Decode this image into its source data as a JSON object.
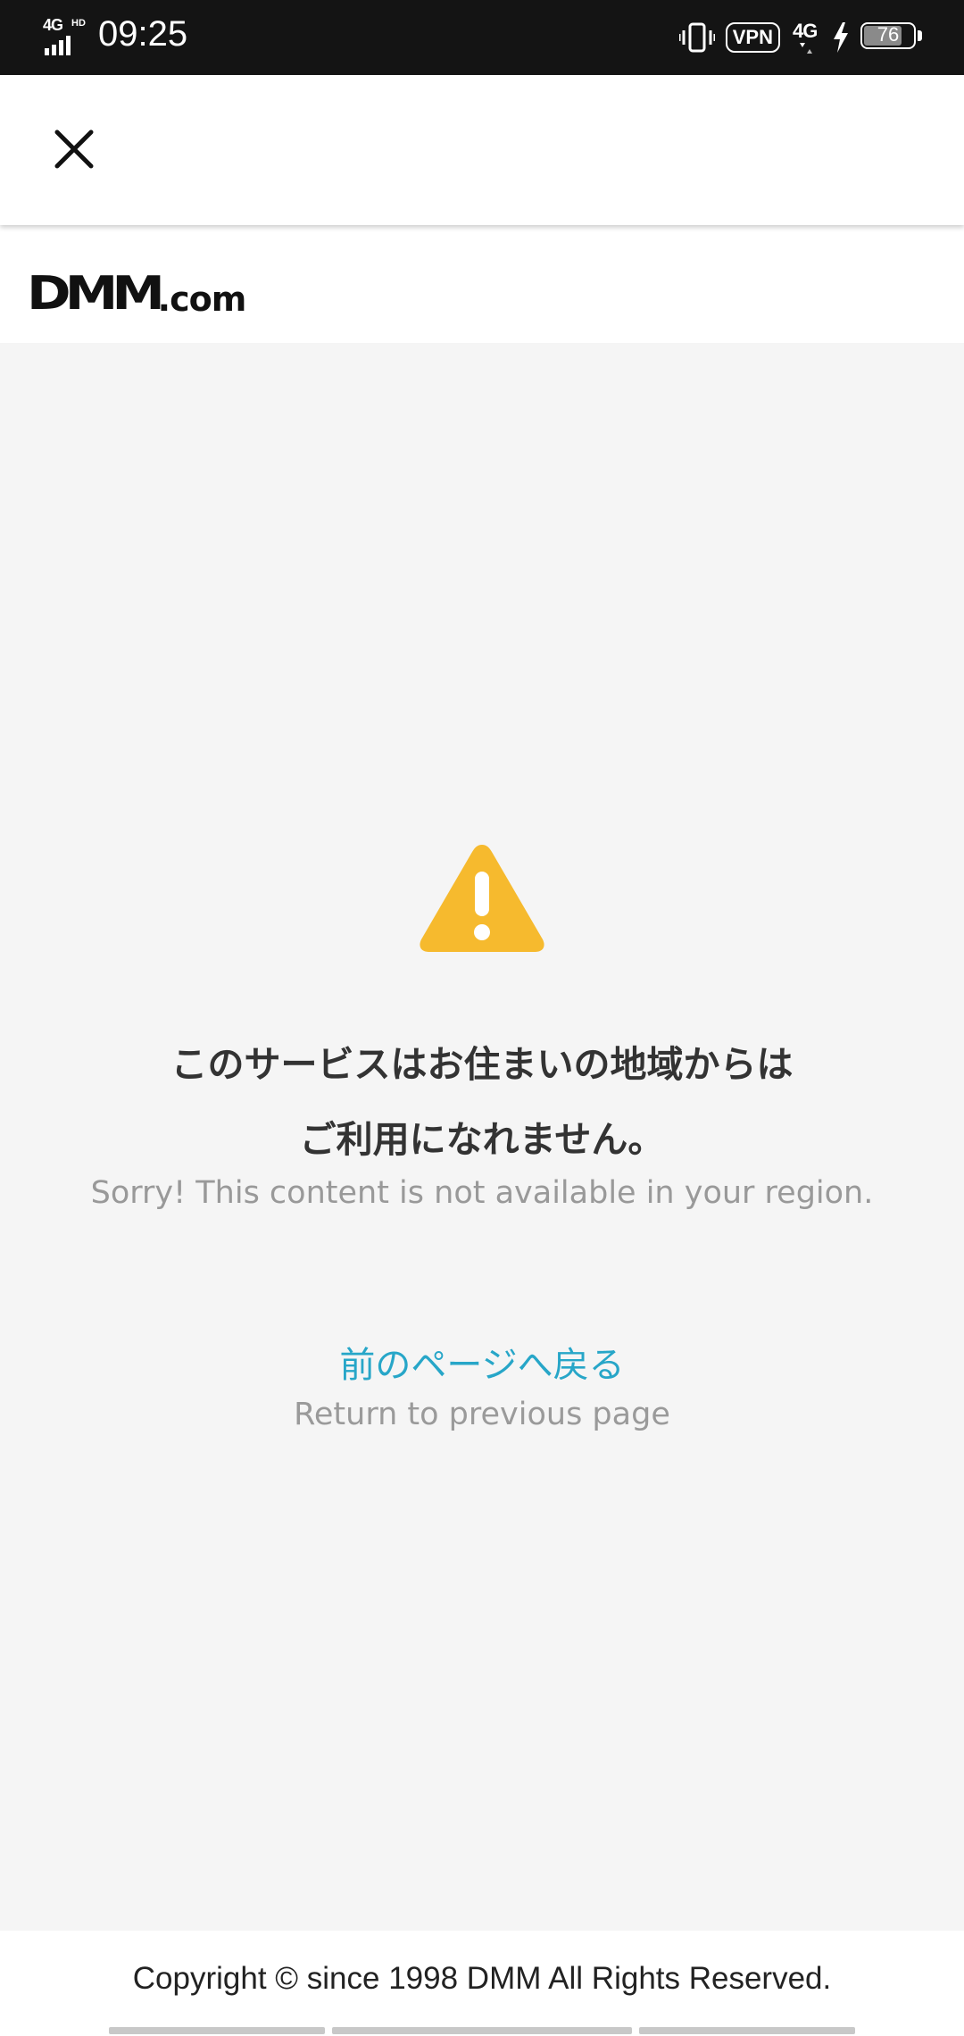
{
  "status_bar": {
    "network_type": "4G",
    "network_badge": "HD",
    "time": "09:25",
    "vpn": "VPN",
    "data_type": "4G",
    "battery_level": "76"
  },
  "header": {
    "logo_main": "DMM",
    "logo_suffix": ".com"
  },
  "main": {
    "warning_icon": "warning-triangle",
    "message_ja_line1": "このサービスはお住まいの地域からは",
    "message_ja_line2": "ご利用になれません。",
    "message_en": "Sorry! This content is not available in your region.",
    "back_link_ja": "前のページへ戻る",
    "back_link_en": "Return to previous page"
  },
  "footer": {
    "copyright": "Copyright © since 1998 DMM All Rights Reserved."
  },
  "colors": {
    "warning": "#F6BA2E",
    "link": "#27A6C8",
    "background": "#F5F5F5",
    "status_bar": "#141414"
  }
}
